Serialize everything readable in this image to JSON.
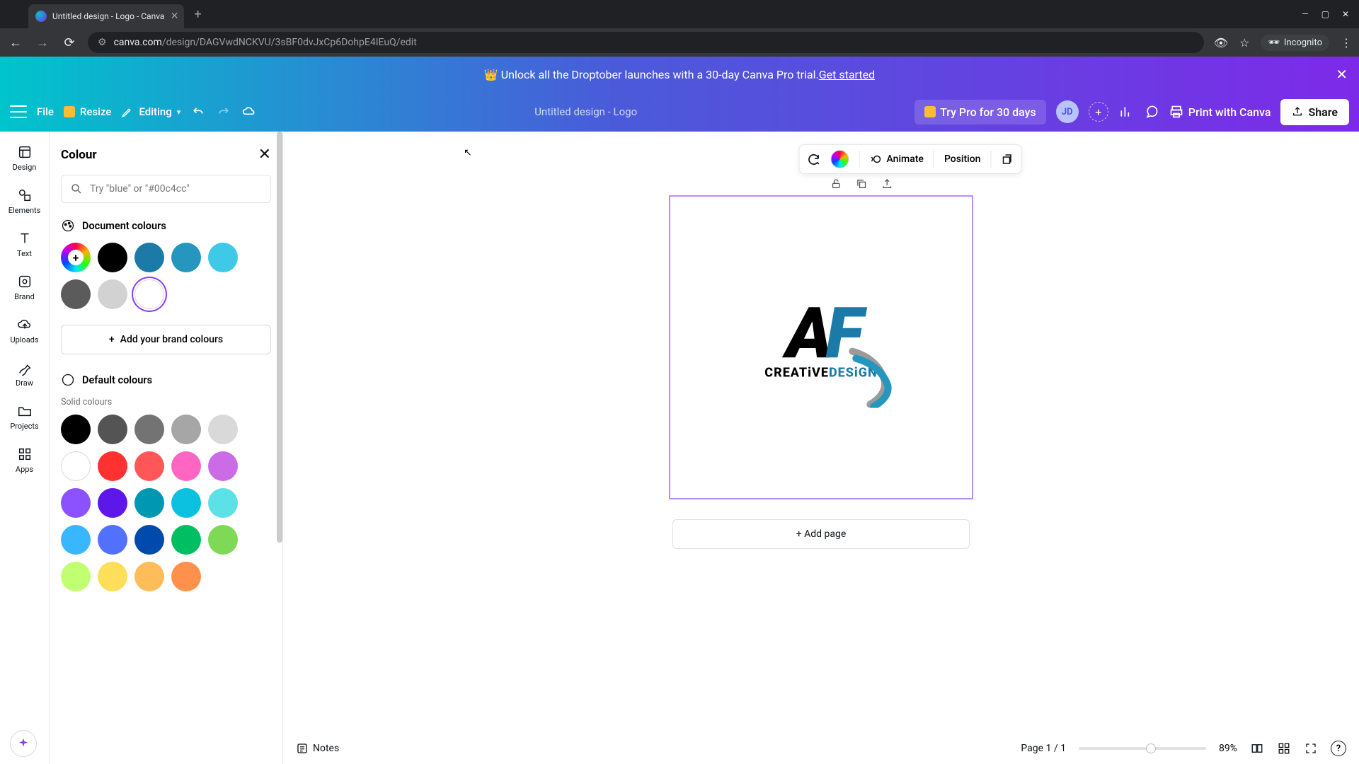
{
  "browser": {
    "tab_title": "Untitled design - Logo - Canva",
    "url_host": "canva.com",
    "url_path": "/design/DAGVwdNCKVU/3sBF0dvJxCp6DohpE4IEuQ/edit",
    "incognito_label": "Incognito"
  },
  "banner": {
    "crown": "👑",
    "text": "Unlock all the Droptober launches with a 30-day Canva Pro trial. ",
    "cta": "Get started"
  },
  "appbar": {
    "file": "File",
    "resize": "Resize",
    "editing": "Editing",
    "doc_title": "Untitled design - Logo",
    "try_pro": "Try Pro for 30 days",
    "avatar_initials": "JD",
    "print": "Print with Canva",
    "share": "Share"
  },
  "vnav": {
    "design": "Design",
    "elements": "Elements",
    "text": "Text",
    "brand": "Brand",
    "uploads": "Uploads",
    "draw": "Draw",
    "projects": "Projects",
    "apps": "Apps"
  },
  "colour_panel": {
    "title": "Colour",
    "search_placeholder": "Try \"blue\" or \"#00c4cc\"",
    "doc_colours_label": "Document colours",
    "doc_colours": [
      "#000000",
      "#1b7aa8",
      "#2596be",
      "#3ec9e6",
      "#5b5b5b",
      "#d2d2d2",
      "#ffffff"
    ],
    "selected_doc_colour": "#ffffff",
    "add_brand": "Add your brand colours",
    "default_label": "Default colours",
    "solid_label": "Solid colours",
    "default_colours_r1": [
      "#000000",
      "#545454",
      "#737373",
      "#a6a6a6",
      "#d9d9d9",
      "#ffffff"
    ],
    "default_colours_r2": [
      "#ff3131",
      "#ff5757",
      "#ff66c4",
      "#cb6ce6",
      "#8c52ff",
      "#5e17eb"
    ],
    "default_colours_r3": [
      "#0097b2",
      "#0cc0df",
      "#5ce1e6",
      "#38b6ff",
      "#5271ff",
      "#004aad"
    ],
    "default_colours_r4": [
      "#00bf63",
      "#7ed957",
      "#c1ff72",
      "#ffde59",
      "#ffbd59",
      "#ff914d"
    ]
  },
  "floating_toolbar": {
    "animate": "Animate",
    "position": "Position"
  },
  "canvas": {
    "logo_letter_a": "A",
    "logo_letter_f": "F",
    "logo_sub_1": "CREATiVE",
    "logo_sub_2": "DESiGN",
    "add_page": "+ Add page"
  },
  "bottombar": {
    "notes": "Notes",
    "page_indicator": "Page 1 / 1",
    "zoom": "89%"
  }
}
